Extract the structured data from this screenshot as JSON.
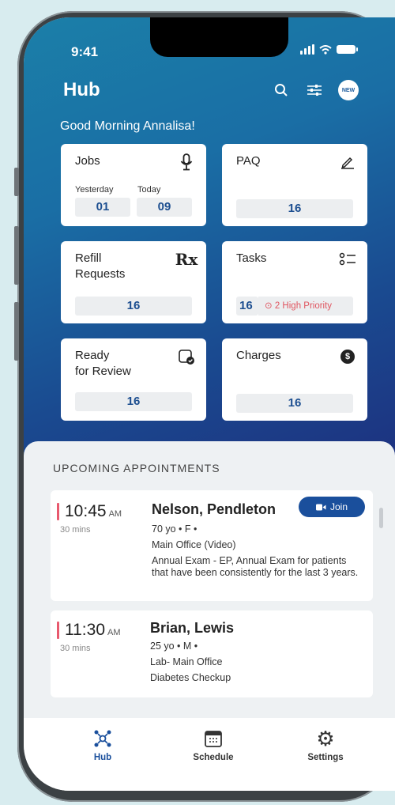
{
  "status": {
    "time": "9:41"
  },
  "header": {
    "title": "Hub",
    "new_badge": "NEW"
  },
  "greeting": "Good Morning Annalisa!",
  "cards": {
    "jobs": {
      "title": "Jobs",
      "yesterday_label": "Yesterday",
      "yesterday_value": "01",
      "today_label": "Today",
      "today_value": "09"
    },
    "paq": {
      "title": "PAQ",
      "value": "16"
    },
    "refill": {
      "title": "Refill\nRequests",
      "icon": "Rx",
      "value": "16"
    },
    "tasks": {
      "title": "Tasks",
      "value": "16",
      "priority": "2 High Priority"
    },
    "review": {
      "title": "Ready\nfor Review",
      "value": "16"
    },
    "charges": {
      "title": "Charges",
      "value": "16"
    }
  },
  "appointments": {
    "heading": "UPCOMING APPOINTMENTS",
    "items": [
      {
        "time": "10:45",
        "ampm": "AM",
        "duration": "30 mins",
        "name": "Nelson, Pendleton",
        "details": "70 yo  •  F  •",
        "location": "Main Office (Video)",
        "reason": "Annual Exam - EP, Annual Exam for patients that have been consistently for the last 3 years.",
        "join_label": "Join"
      },
      {
        "time": "11:30",
        "ampm": "AM",
        "duration": "30 mins",
        "name": "Brian, Lewis",
        "details": "25 yo  •  M  •",
        "location": "Lab- Main Office",
        "reason": "Diabetes Checkup"
      }
    ]
  },
  "tabs": [
    {
      "label": "Hub",
      "icon": "hub-icon",
      "active": true
    },
    {
      "label": "Schedule",
      "icon": "calendar-icon",
      "active": false
    },
    {
      "label": "Settings",
      "icon": "gear-icon",
      "active": false
    }
  ],
  "colors": {
    "brand": "#1a4f9c",
    "accent_red": "#e8596e",
    "hero_start": "#1b7fa8",
    "hero_end": "#1d3280"
  }
}
